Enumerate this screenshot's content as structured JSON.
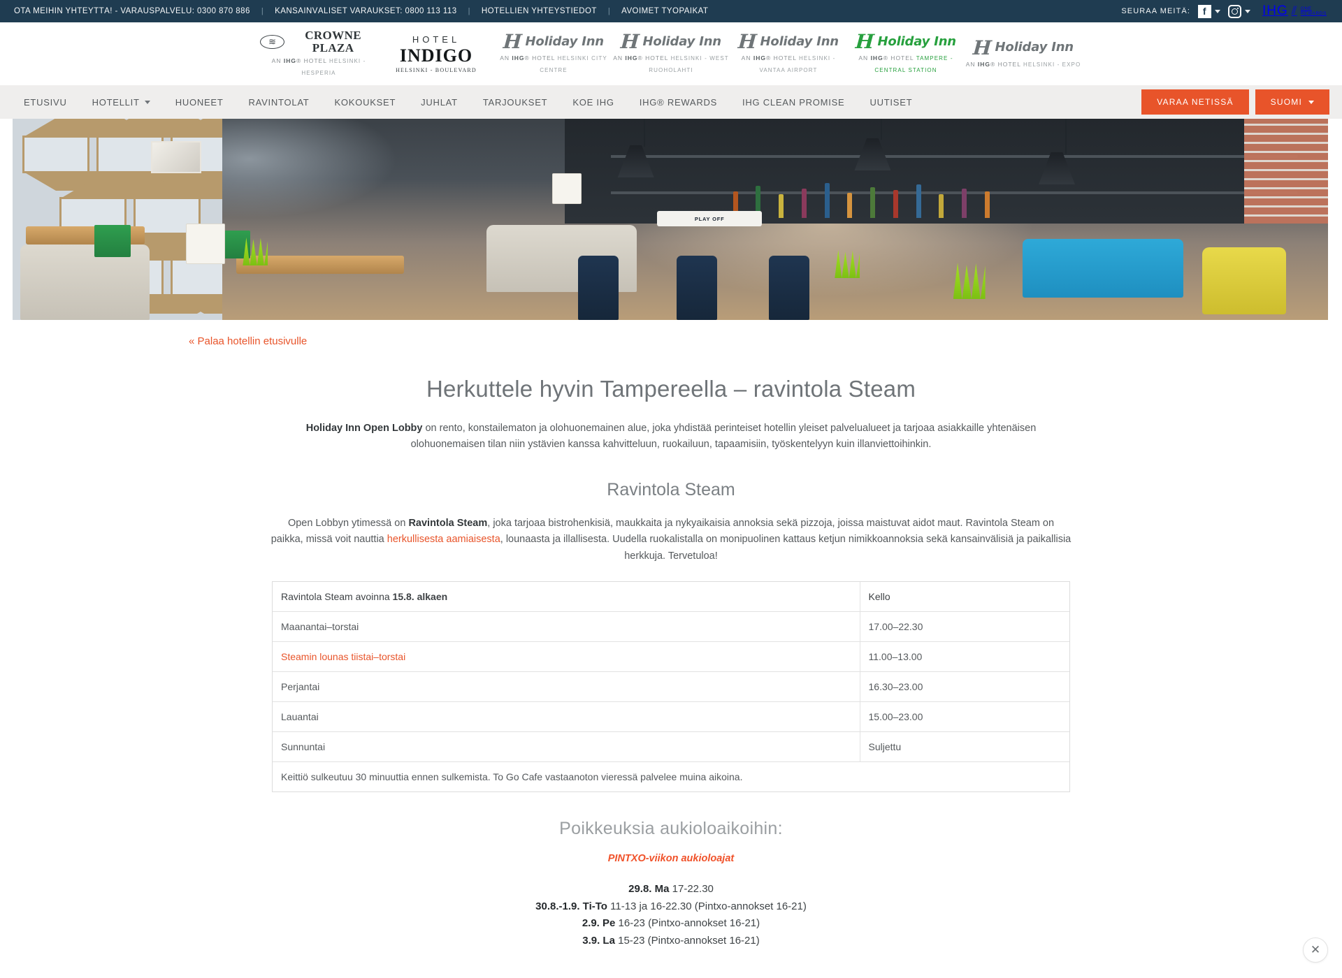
{
  "topbar": {
    "links": [
      "OTA MEIHIN YHTEYTTÄ! - VARAUSPALVELU: 0300 870 886",
      "KANSAINVÄLISET VARAUKSET: 0800 113 113",
      "HOTELLIEN YHTEYSTIEDOT",
      "AVOIMET TYÖPAIKAT"
    ],
    "separator": "|",
    "follow_label": "SEURAA MEITÄ:",
    "facebook_glyph": "f",
    "ihg_word": "IHG",
    "one_rewards_line1": "ONE",
    "one_rewards_line2": "REWARDS"
  },
  "logos": [
    {
      "type": "crowne",
      "brand": "CROWNE PLAZA",
      "sub_pre": "AN ",
      "sub_ihg": "IHG",
      "sub_post": "® HOTEL",
      "city": "HELSINKI - HESPERIA"
    },
    {
      "type": "indigo",
      "top": "HOTEL",
      "brand": "INDIGO",
      "city": "HELSINKI - BOULEVARD"
    },
    {
      "type": "holiday",
      "brand": "Holiday Inn",
      "sub_pre": "AN ",
      "sub_ihg": "IHG",
      "sub_post": "® HOTEL",
      "city": "HELSINKI CITY CENTRE",
      "green": false
    },
    {
      "type": "holiday",
      "brand": "Holiday Inn",
      "sub_pre": "AN ",
      "sub_ihg": "IHG",
      "sub_post": "® HOTEL",
      "city": "HELSINKI - WEST RUOHOLAHTI",
      "green": false
    },
    {
      "type": "holiday",
      "brand": "Holiday Inn",
      "sub_pre": "AN ",
      "sub_ihg": "IHG",
      "sub_post": "® HOTEL",
      "city": "HELSINKI - VANTAA AIRPORT",
      "green": false
    },
    {
      "type": "holiday",
      "brand": "Holiday Inn",
      "sub_pre": "AN ",
      "sub_ihg": "IHG",
      "sub_post": "® HOTEL",
      "city": "TAMPERE - CENTRAL STATION",
      "green": true
    },
    {
      "type": "holiday",
      "brand": "Holiday Inn",
      "sub_pre": "AN ",
      "sub_ihg": "IHG",
      "sub_post": "® HOTEL",
      "city": "HELSINKI - EXPO",
      "green": false
    }
  ],
  "nav": {
    "items": [
      {
        "label": "ETUSIVU",
        "has_caret": false
      },
      {
        "label": "HOTELLIT",
        "has_caret": true
      },
      {
        "label": "HUONEET",
        "has_caret": false
      },
      {
        "label": "RAVINTOLAT",
        "has_caret": false
      },
      {
        "label": "KOKOUKSET",
        "has_caret": false
      },
      {
        "label": "JUHLAT",
        "has_caret": false
      },
      {
        "label": "TARJOUKSET",
        "has_caret": false
      },
      {
        "label": "KOE IHG",
        "has_caret": false
      },
      {
        "label": "IHG® REWARDS",
        "has_caret": false
      },
      {
        "label": "IHG CLEAN PROMISE",
        "has_caret": false
      },
      {
        "label": "UUTISET",
        "has_caret": false
      }
    ],
    "book_button": "VARAA NETISSÄ",
    "language_button": "SUOMI",
    "accent_color": "#e8542a"
  },
  "hero": {
    "sign_text": "PLAY OFF"
  },
  "main": {
    "back_link": "« Palaa hotellin etusivulle",
    "page_title": "Herkuttele hyvin Tampereella – ravintola Steam",
    "lede_bold": "Holiday Inn Open Lobby",
    "lede_rest": " on rento, konstailematon ja olohuonemainen alue, joka yhdistää perinteiset hotellin yleiset palvelualueet ja tarjoaa asiakkaille yhtenäisen olohuonemaisen tilan niin ystävien kanssa kahvitteluun, ruokailuun, tapaamisiin, työskentelyyn kuin illanviettoihinkin.",
    "section_title": "Ravintola Steam",
    "para_part1": "Open Lobbyn ytimessä on ",
    "para_bold1": "Ravintola Steam",
    "para_part2": ", joka tarjoaa bistrohenkisiä, maukkaita ja nykyaikaisia annoksia sekä pizzoja, joissa maistuvat aidot maut. Ravintola Steam on paikka, missä voit nauttia ",
    "para_link": "herkullisesta aamiaisesta",
    "para_part3": ", lounaasta ja illallisesta. Uudella ruokalistalla on monipuolinen kattaus ketjun nimikkoannoksia sekä kansainvälisiä ja paikallisia herkkuja. Tervetuloa!"
  },
  "hours_table": {
    "header_left_normal": "Ravintola Steam avoinna ",
    "header_left_bold": "15.8. alkaen",
    "header_right": "Kello",
    "rows": [
      {
        "day": "Maanantai–torstai",
        "time": "17.00–22.30",
        "accent": false
      },
      {
        "day": "Steamin lounas tiistai–torstai",
        "time": "11.00–13.00",
        "accent": true
      },
      {
        "day": "Perjantai",
        "time": "16.30–23.00",
        "accent": false
      },
      {
        "day": "Lauantai",
        "time": "15.00–23.00",
        "accent": false
      },
      {
        "day": "Sunnuntai",
        "time": "Suljettu",
        "accent": false
      }
    ],
    "note": "Keittiö sulkeutuu 30 minuuttia ennen sulkemista. To Go Cafe vastaanoton vieressä palvelee muina aikoina."
  },
  "exceptions": {
    "title": "Poikkeuksia aukioloaikoihin:",
    "subtitle": "PINTXO-viikon aukioloajat",
    "lines": [
      {
        "bold": "29.8. Ma ",
        "rest": "17-22.30"
      },
      {
        "bold": "30.8.-1.9. Ti-To ",
        "rest": "11-13 ja 16-22.30 (Pintxo-annokset 16-21)"
      },
      {
        "bold": "2.9. Pe ",
        "rest": "16-23 (Pintxo-annokset 16-21)"
      },
      {
        "bold": "3.9. La ",
        "rest": "15-23 (Pintxo-annokset 16-21)"
      }
    ]
  },
  "overlay": {
    "close_glyph": "✕"
  }
}
